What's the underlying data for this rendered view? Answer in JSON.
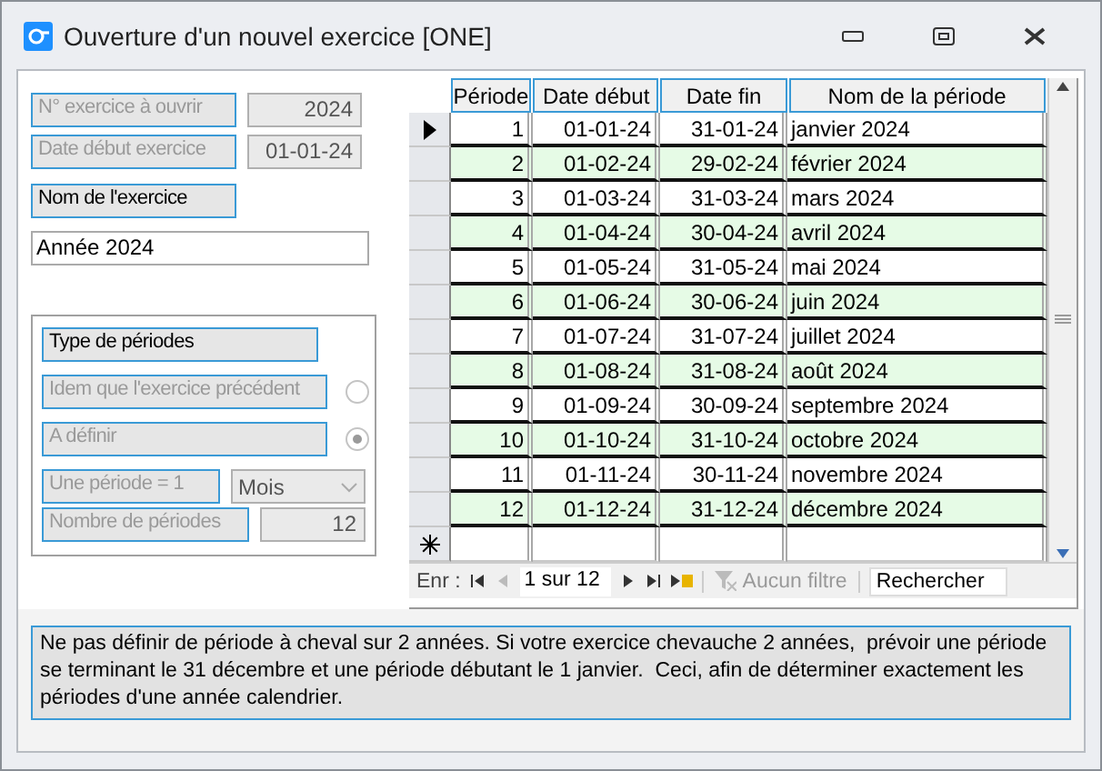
{
  "window": {
    "title": "Ouverture d'un nouvel exercice [ONE]"
  },
  "fields": [
    {
      "label": "N° exercice à ouvrir",
      "value": "2024",
      "disabled": true
    },
    {
      "label": "Date début exercice",
      "value": "01-01-24",
      "disabled": true
    }
  ],
  "name_field": {
    "label": "Nom de l'exercice",
    "value": "Année 2024"
  },
  "period_type": {
    "title": "Type de périodes",
    "options": [
      {
        "label": "Idem que l'exercice précédent",
        "selected": false,
        "disabled": true
      },
      {
        "label": "A définir",
        "selected": true,
        "disabled": true
      }
    ],
    "unit": {
      "label": "Une période = 1",
      "value": "Mois",
      "disabled": true
    },
    "count": {
      "label": "Nombre de périodes",
      "value": "12",
      "disabled": true
    }
  },
  "table": {
    "columns": [
      "Période",
      "Date début",
      "Date fin",
      "Nom de la période"
    ],
    "rows": [
      {
        "cells": [
          "1",
          "01-01-24",
          "31-01-24",
          "janvier 2024"
        ],
        "current": true
      },
      {
        "cells": [
          "2",
          "01-02-24",
          "29-02-24",
          "février 2024"
        ],
        "current": false
      },
      {
        "cells": [
          "3",
          "01-03-24",
          "31-03-24",
          "mars 2024"
        ],
        "current": false
      },
      {
        "cells": [
          "4",
          "01-04-24",
          "30-04-24",
          "avril 2024"
        ],
        "current": false
      },
      {
        "cells": [
          "5",
          "01-05-24",
          "31-05-24",
          "mai 2024"
        ],
        "current": false
      },
      {
        "cells": [
          "6",
          "01-06-24",
          "30-06-24",
          "juin 2024"
        ],
        "current": false
      },
      {
        "cells": [
          "7",
          "01-07-24",
          "31-07-24",
          "juillet 2024"
        ],
        "current": false
      },
      {
        "cells": [
          "8",
          "01-08-24",
          "31-08-24",
          "août 2024"
        ],
        "current": false
      },
      {
        "cells": [
          "9",
          "01-09-24",
          "30-09-24",
          "septembre 2024"
        ],
        "current": false
      },
      {
        "cells": [
          "10",
          "01-10-24",
          "31-10-24",
          "octobre 2024"
        ],
        "current": false
      },
      {
        "cells": [
          "11",
          "01-11-24",
          "30-11-24",
          "novembre 2024"
        ],
        "current": false
      },
      {
        "cells": [
          "12",
          "01-12-24",
          "31-12-24",
          "décembre 2024"
        ],
        "current": false
      }
    ]
  },
  "navigation": {
    "label": "Enr :",
    "position": "1 sur 12",
    "filter": "Aucun filtre",
    "search": {
      "placeholder": "Rechercher"
    }
  },
  "note": "Ne pas définir de période à cheval sur 2 années. Si votre exercice chevauche 2 années,  prévoir une période se terminant le 31 décembre et une période débutant le 1 janvier.  Ceci, afin de déterminer exactement les périodes d'une année calendrier."
}
